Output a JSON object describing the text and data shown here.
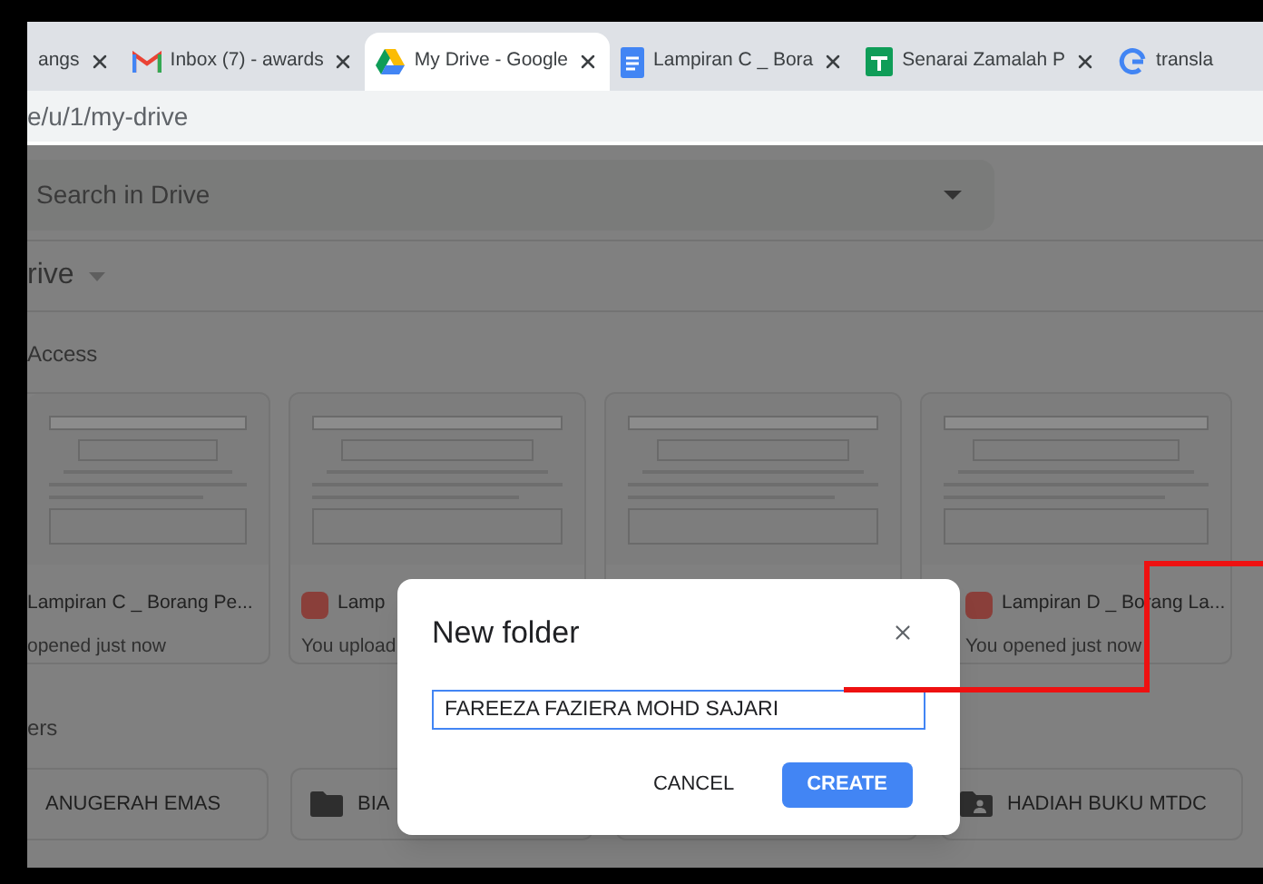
{
  "browser": {
    "tabs": [
      {
        "title": "angs",
        "kind": "plain",
        "selected": false
      },
      {
        "title": "Inbox (7) - awards",
        "kind": "mail",
        "selected": false
      },
      {
        "title": "My Drive - Google",
        "kind": "drive",
        "selected": true
      },
      {
        "title": "Lampiran C _ Bora",
        "kind": "doc",
        "selected": false
      },
      {
        "title": "Senarai Zamalah P",
        "kind": "sheet",
        "selected": false
      },
      {
        "title": "transla",
        "kind": "google",
        "selected": false
      }
    ],
    "address": "e/u/1/my-drive"
  },
  "drive": {
    "search": {
      "placeholder": "Search in Drive"
    },
    "location": "rive",
    "quick_access": "Access",
    "files": [
      {
        "name": "Lampiran C _ Borang Pe...",
        "detail": "opened just now",
        "kind": "plain"
      },
      {
        "name": "Lamp",
        "detail": "You upload",
        "kind": "pdf"
      },
      {
        "kind": "plain"
      },
      {
        "name": "Lampiran D _ Borang La...",
        "detail": "You opened just now",
        "kind": "pdf"
      }
    ],
    "folders_heading": "ers",
    "folders": [
      {
        "name": "ANUGERAH EMAS",
        "kind": "plain"
      },
      {
        "name": "BIA",
        "kind": "folder"
      },
      {
        "kind": "plain"
      },
      {
        "name": "HADIAH BUKU MTDC",
        "kind": "shared"
      }
    ]
  },
  "dialog": {
    "title": "New folder",
    "value": "FAREEZA FAZIERA MOHD SAJARI",
    "buttons": [
      {
        "label": "CANCEL",
        "kind": "text"
      },
      {
        "label": "CREATE",
        "kind": "primary"
      }
    ]
  }
}
